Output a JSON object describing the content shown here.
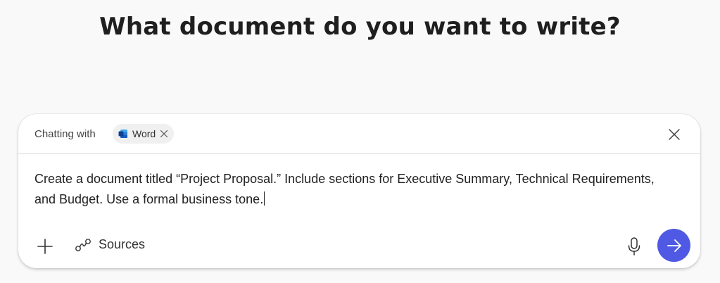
{
  "headline": "What document do you want to write?",
  "chat": {
    "chatting_with_label": "Chatting with",
    "chip": {
      "label": "Word",
      "icon": "word-icon",
      "remove_icon": "close-icon"
    },
    "close_icon": "close-icon",
    "prompt": "Create a document titled “Project Proposal.” Include sections for Executive Summary, Technical Requirements, and Budget. Use a formal business tone.",
    "toolbar": {
      "add_icon": "plus-icon",
      "sources_icon": "sources-icon",
      "sources_label": "Sources",
      "mic_icon": "microphone-icon",
      "send_icon": "arrow-right-icon"
    }
  },
  "colors": {
    "background": "#f9f9f9",
    "card": "#ffffff",
    "send_button": "#4f59e3",
    "word_brand": "#185abd"
  }
}
